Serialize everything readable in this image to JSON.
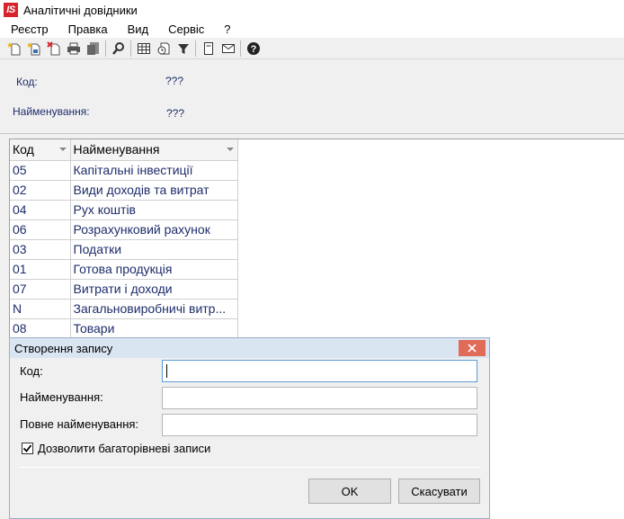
{
  "window": {
    "logo_text": "IS",
    "title": "Аналітичні довідники"
  },
  "menu": [
    "Реєстр",
    "Правка",
    "Вид",
    "Сервіс",
    "?"
  ],
  "toolbar": {
    "icons": [
      "new-doc-icon",
      "new-doc-child-icon",
      "delete-doc-icon",
      "print-icon",
      "export-icon",
      "search-icon",
      "table-icon",
      "timer-icon",
      "filter-icon",
      "page-icon",
      "mail-icon",
      "help-icon"
    ]
  },
  "header": {
    "code_label": "Код:",
    "code_value": "???",
    "name_label": "Найменування:",
    "name_value": "???"
  },
  "grid": {
    "columns": [
      "Код",
      "Найменування"
    ],
    "rows": [
      [
        "05",
        "Капітальні інвестиції"
      ],
      [
        "02",
        "Види доходів та витрат"
      ],
      [
        "04",
        "Рух коштів"
      ],
      [
        "06",
        "Розрахунковий рахунок"
      ],
      [
        "03",
        "Податки"
      ],
      [
        "01",
        "Готова продукція"
      ],
      [
        "07",
        "Витрати і доходи"
      ],
      [
        "N",
        "Загальновиробничі витр..."
      ],
      [
        "08",
        "Товари"
      ]
    ]
  },
  "dialog": {
    "title": "Створення запису",
    "code_label": "Код:",
    "code_value": "",
    "name_label": "Найменування:",
    "name_value": "",
    "fullname_label": "Повне найменування:",
    "fullname_value": "",
    "checkbox_label": "Дозволити багаторівневі записи",
    "checkbox_checked": true,
    "ok_label": "OK",
    "cancel_label": "Скасувати"
  },
  "colors": {
    "accent_text": "#1e2d6a",
    "close_button": "#e06b58",
    "dialog_title_bg": "#dae5f2"
  }
}
